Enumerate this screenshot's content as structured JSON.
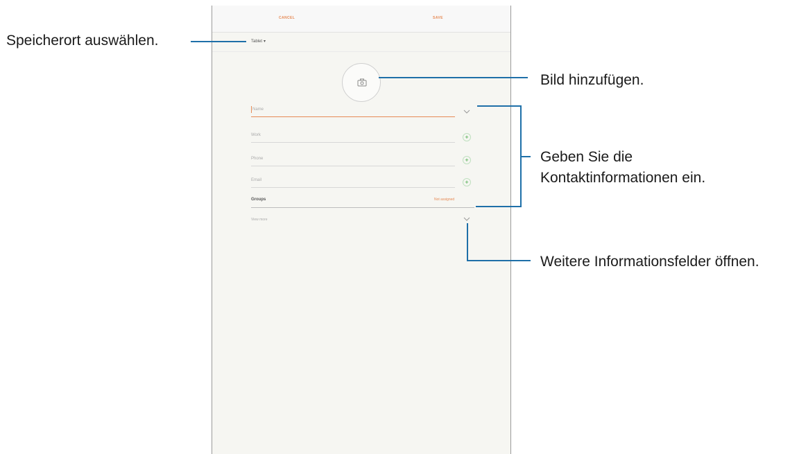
{
  "topbar": {
    "cancel_label": "CANCEL",
    "save_label": "SAVE"
  },
  "storage": {
    "label": "Tablet",
    "icon": "dropdown-caret-icon"
  },
  "photo": {
    "icon": "camera-icon"
  },
  "fields": {
    "name_placeholder": "Name",
    "work_placeholder": "Work",
    "phone_placeholder": "Phone",
    "email_placeholder": "Email"
  },
  "groups": {
    "label": "Groups",
    "value": "Not assigned"
  },
  "view_more_label": "View more",
  "colors": {
    "accent": "#e68a55",
    "add": "#3aa43a",
    "callout_line": "#1e6fa8"
  },
  "callouts": {
    "storage": "Speicherort auswählen.",
    "photo": "Bild hinzufügen.",
    "contact_line1": "Geben Sie die",
    "contact_line2": "Kontaktinformationen ein.",
    "more_fields": "Weitere Informationsfelder öffnen."
  }
}
